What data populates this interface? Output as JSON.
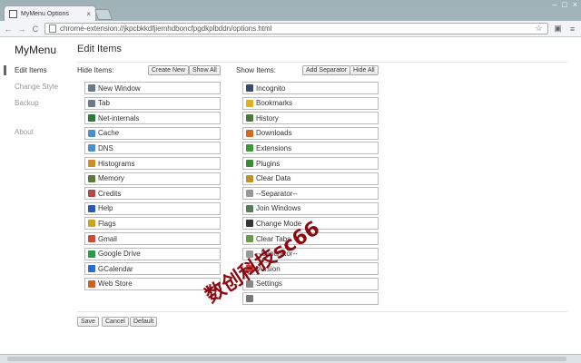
{
  "browser": {
    "tab_title": "MyMenu Options",
    "tab_close": "×",
    "window_controls": [
      "–",
      "□",
      "×"
    ],
    "back": "←",
    "forward": "→",
    "reload": "C",
    "url": "chrome-extension://jkpcbkkdfjiemhdboncfpgdkplbddn/options.html",
    "star": "☆",
    "menu": "≡"
  },
  "app": {
    "logo": "MyMenu",
    "heading": "Edit Items"
  },
  "sidebar": {
    "items": [
      {
        "label": "Edit Items",
        "active": true
      },
      {
        "label": "Change Style"
      },
      {
        "label": "Backup"
      },
      {
        "label": "About"
      }
    ]
  },
  "hide_col": {
    "label": "Hide Items:",
    "create_new": "Create New",
    "show_all": "Show All",
    "items": [
      {
        "label": "New Window",
        "icon": "window-icon",
        "color": "#6a7a8a"
      },
      {
        "label": "Tab",
        "icon": "tab-icon",
        "color": "#6a7a8a"
      },
      {
        "label": "Net-internals",
        "icon": "net-icon",
        "color": "#2a7a3a"
      },
      {
        "label": "Cache",
        "icon": "cache-icon",
        "color": "#4a8fd0"
      },
      {
        "label": "DNS",
        "icon": "dns-icon",
        "color": "#4a8fd0"
      },
      {
        "label": "Histograms",
        "icon": "histogram-icon",
        "color": "#d08a2a"
      },
      {
        "label": "Memory",
        "icon": "memory-icon",
        "color": "#5a7a3a"
      },
      {
        "label": "Credits",
        "icon": "credits-icon",
        "color": "#b04a4a"
      },
      {
        "label": "Help",
        "icon": "help-icon",
        "color": "#2a5ab0"
      },
      {
        "label": "Flags",
        "icon": "flags-icon",
        "color": "#d0a020"
      },
      {
        "label": "Gmail",
        "icon": "gmail-icon",
        "color": "#d04a3a"
      },
      {
        "label": "Google Drive",
        "icon": "drive-icon",
        "color": "#2a9a4a"
      },
      {
        "label": "GCalendar",
        "icon": "calendar-icon",
        "color": "#2a6ad0"
      },
      {
        "label": "Web Store",
        "icon": "store-icon",
        "color": "#d0602a"
      }
    ]
  },
  "show_col": {
    "label": "Show Items:",
    "add_separator": "Add Separator",
    "hide_all": "Hide All",
    "items": [
      {
        "label": "Incognito",
        "icon": "incognito-icon",
        "color": "#3a4a6a"
      },
      {
        "label": "Bookmarks",
        "icon": "bookmarks-icon",
        "color": "#e0b020"
      },
      {
        "label": "History",
        "icon": "history-icon",
        "color": "#4a7a3a"
      },
      {
        "label": "Downloads",
        "icon": "downloads-icon",
        "color": "#d06a20"
      },
      {
        "label": "Extensions",
        "icon": "extensions-icon",
        "color": "#3a9a3a"
      },
      {
        "label": "Plugins",
        "icon": "plugins-icon",
        "color": "#3a8a3a"
      },
      {
        "label": "Clear Data",
        "icon": "clear-data-icon",
        "color": "#c0902a"
      },
      {
        "label": "--Separator--",
        "icon": "separator-icon",
        "color": "#999999"
      },
      {
        "label": "Join Windows",
        "icon": "join-windows-icon",
        "color": "#5a7a5a"
      },
      {
        "label": "Change Mode",
        "icon": "change-mode-icon",
        "color": "#333333"
      },
      {
        "label": "Clear Tabs",
        "icon": "clear-tabs-icon",
        "color": "#6a9a4a"
      },
      {
        "label": "--Separator--",
        "icon": "separator-icon",
        "color": "#999999"
      },
      {
        "label": "Version",
        "icon": "version-icon",
        "color": "#d04040"
      },
      {
        "label": "Settings",
        "icon": "settings-icon",
        "color": "#888888"
      },
      {
        "label": "",
        "icon": "blank-icon",
        "color": "#777777"
      }
    ]
  },
  "footer": {
    "save": "Save",
    "cancel": "Cancel",
    "default": "Default"
  },
  "watermark": "数创科技sc66"
}
